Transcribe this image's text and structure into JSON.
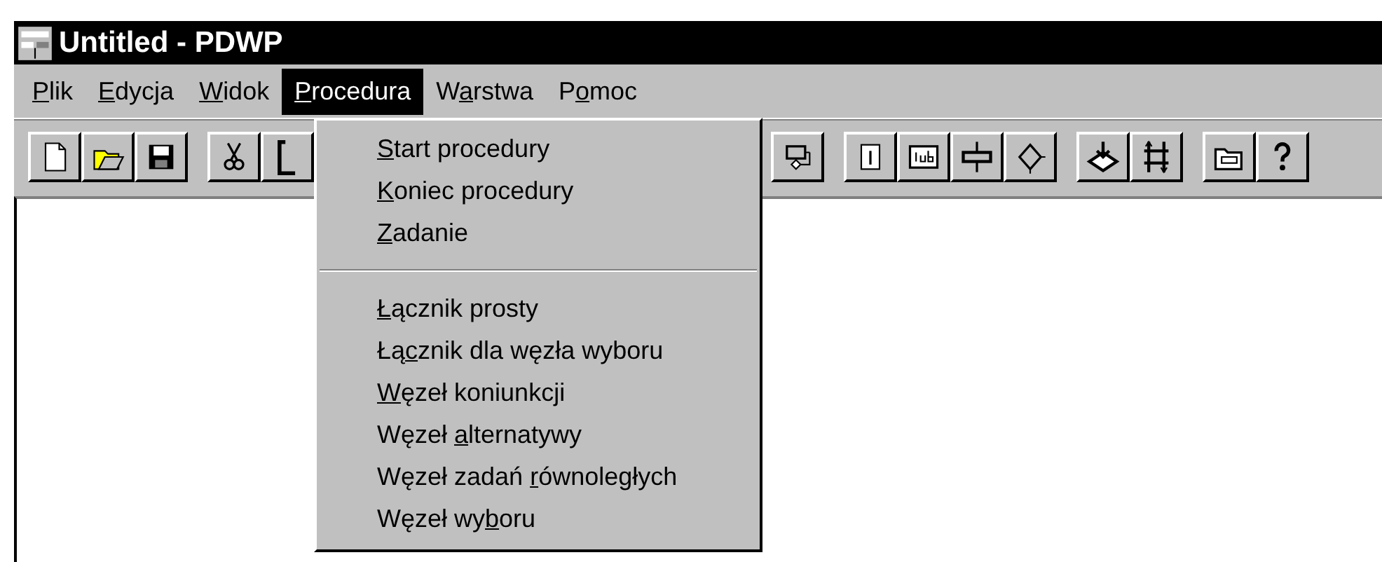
{
  "window": {
    "title": "Untitled - PDWP"
  },
  "menubar": [
    {
      "key": "P",
      "post": "lik",
      "selected": false
    },
    {
      "key": "E",
      "post": "dycja",
      "selected": false
    },
    {
      "key": "W",
      "post": "idok",
      "selected": false
    },
    {
      "key": "P",
      "post": "rocedura",
      "selected": true
    },
    {
      "pre": "W",
      "key": "a",
      "post": "rstwa",
      "selected": false
    },
    {
      "pre": "P",
      "key": "o",
      "post": "moc",
      "selected": false
    }
  ],
  "menu": {
    "items": [
      {
        "kind": "item",
        "key": "S",
        "post": "tart procedury"
      },
      {
        "kind": "item",
        "key": "K",
        "post": "oniec procedury"
      },
      {
        "kind": "item",
        "key": "Z",
        "post": "adanie"
      },
      {
        "kind": "separator"
      },
      {
        "kind": "item",
        "key": "Ł",
        "post": "ącznik prosty"
      },
      {
        "kind": "item",
        "pre": "Łą",
        "key": "c",
        "post": "znik dla węzła wyboru"
      },
      {
        "kind": "item",
        "key": "W",
        "post": "ęzeł koniunkcji"
      },
      {
        "kind": "item",
        "pre": "Węzeł ",
        "key": "a",
        "post": "lternatywy"
      },
      {
        "kind": "item",
        "pre": "Węzeł zadań ",
        "key": "r",
        "post": "ównoległych"
      },
      {
        "kind": "item",
        "pre": "Węzeł wy",
        "key": "b",
        "post": "oru"
      }
    ]
  }
}
